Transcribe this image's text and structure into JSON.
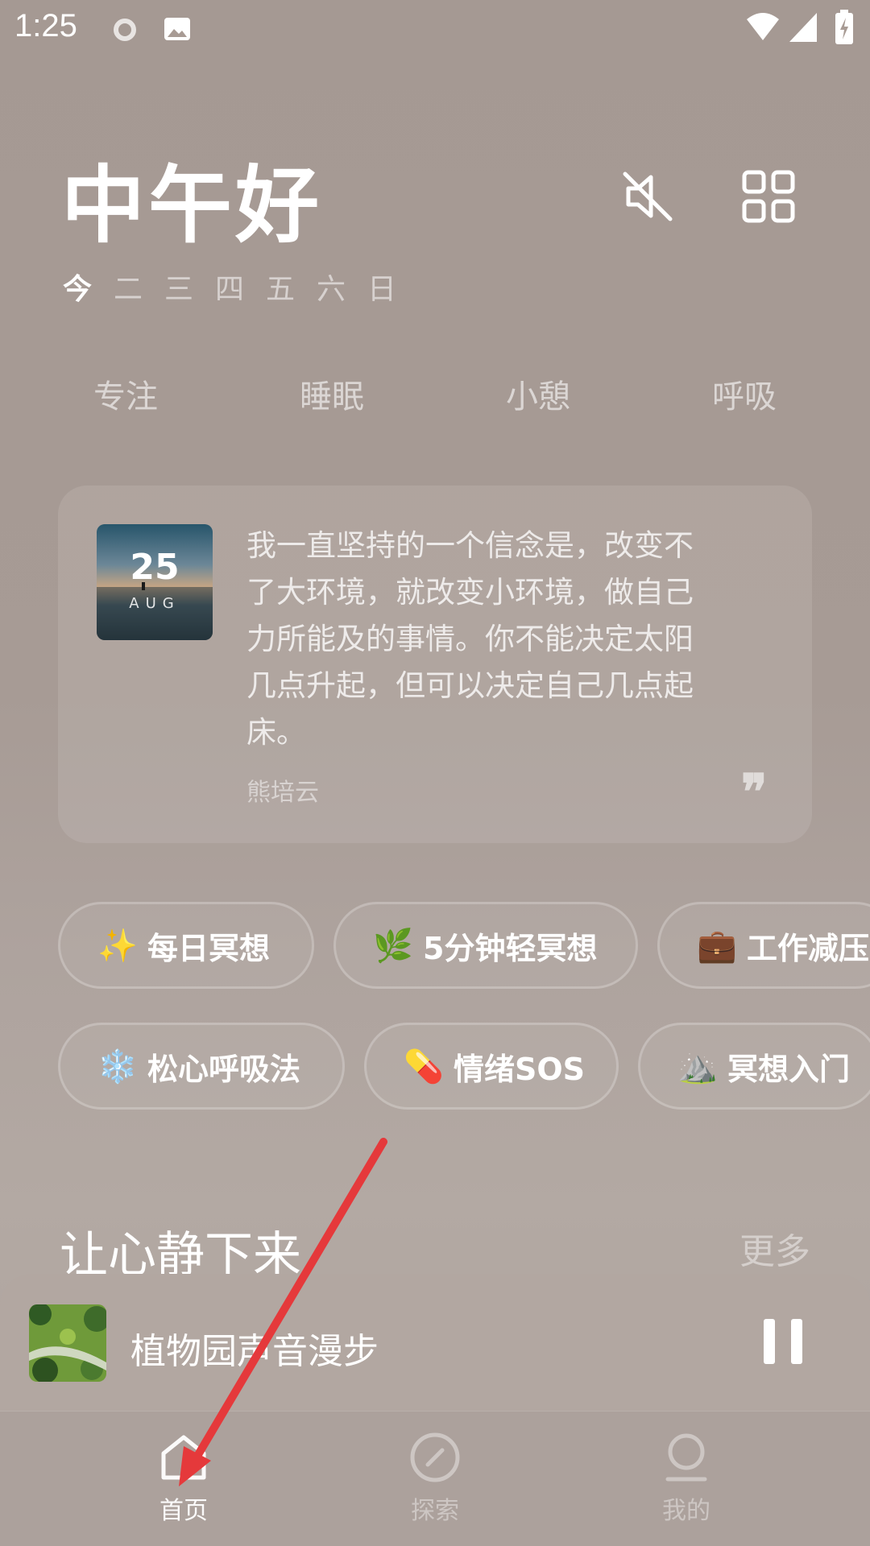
{
  "status_bar": {
    "time": "1:25"
  },
  "header": {
    "greeting": "中午好",
    "weekdays": [
      "今",
      "二",
      "三",
      "四",
      "五",
      "六",
      "日"
    ]
  },
  "categories": [
    "专注",
    "睡眠",
    "小憩",
    "呼吸"
  ],
  "quote_card": {
    "date_day": "25",
    "date_month": "AUG",
    "text": "我一直坚持的一个信念是，改变不了大环境，就改变小环境，做自己力所能及的事情。你不能决定太阳几点升起，但可以决定自己几点起床。",
    "author": "熊培云",
    "quote_mark": "❞"
  },
  "chips_row1": [
    {
      "icon": "✨",
      "label": "每日冥想"
    },
    {
      "icon": "🌿",
      "label": "5分钟轻冥想"
    },
    {
      "icon": "💼",
      "label": "工作减压"
    }
  ],
  "chips_row2": [
    {
      "icon": "❄️",
      "label": "松心呼吸法"
    },
    {
      "icon": "💊",
      "label": "情绪SOS"
    },
    {
      "icon": "⛰️",
      "label": "冥想入门"
    }
  ],
  "section": {
    "title": "让心静下来",
    "more": "更多"
  },
  "now_playing": {
    "title": "植物园声音漫步"
  },
  "bottom_nav": [
    {
      "label": "首页",
      "icon": "home-icon",
      "active": true
    },
    {
      "label": "探索",
      "icon": "compass-icon",
      "active": false
    },
    {
      "label": "我的",
      "icon": "profile-icon",
      "active": false
    }
  ],
  "colors": {
    "background": "#a89b94",
    "annotation_arrow": "#e5393b"
  }
}
